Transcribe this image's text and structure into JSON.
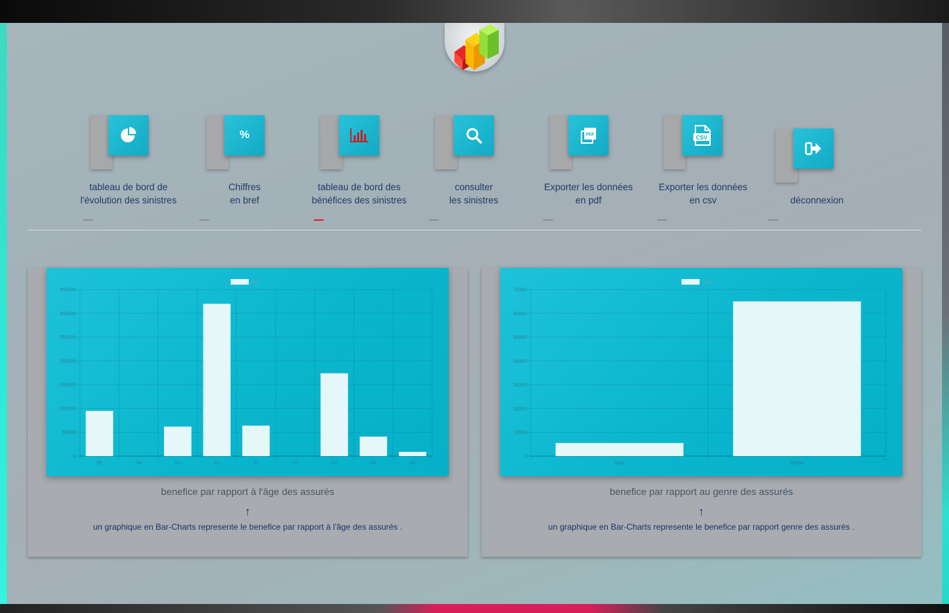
{
  "nav": {
    "items": [
      {
        "label": "tableau de bord de\nl'évolution des sinistres",
        "icon": "pie-chart-icon",
        "active": false
      },
      {
        "label": "Chiffres\nen bref",
        "icon": "percent-icon",
        "icon_text": "%",
        "active": false
      },
      {
        "label": "tableau de bord des\nbénéfices des sinistres",
        "icon": "bar-chart-icon",
        "active": true
      },
      {
        "label": "consulter\nles sinistres",
        "icon": "search-icon",
        "active": false
      },
      {
        "label": "Exporter les données\nen pdf",
        "icon": "pdf-icon",
        "icon_text": "PDF",
        "active": false
      },
      {
        "label": "Exporter les données\nen csv",
        "icon": "csv-icon",
        "icon_text": "CSV",
        "active": false
      },
      {
        "label": "déconnexion",
        "icon": "logout-icon",
        "active": false
      }
    ]
  },
  "cards": [
    {
      "title": "benefice par rapport à l'âge des assurés",
      "arrow": "↑",
      "description": "un graphique en Bar-Charts represente le benefice par rapport à l'âge des assurés ."
    },
    {
      "title": "benefice par rapport au genre des assurés",
      "arrow": "↑",
      "description": "un graphique en Bar-Charts represente le benefice par rapport genre des assurés ."
    }
  ],
  "colors": {
    "accent": "#13aac4",
    "active_underline": "#d8232a",
    "bar_fill": "#e6f7fa"
  },
  "chart_data": [
    {
      "type": "bar",
      "legend": "age",
      "categories": [
        "55",
        "54",
        "60",
        "62",
        "51",
        "10",
        "50",
        "58",
        "40"
      ],
      "values": [
        95000,
        0,
        62000,
        320000,
        64000,
        0,
        174000,
        41000,
        9000
      ],
      "ylim": [
        0,
        350000
      ],
      "yticks": [
        0,
        50000,
        100000,
        150000,
        200000,
        250000,
        300000,
        350000
      ],
      "grid": true
    },
    {
      "type": "bar",
      "legend": "genre",
      "categories": [
        "male",
        "female"
      ],
      "values": [
        5500,
        65000
      ],
      "ylim": [
        0,
        70000
      ],
      "yticks": [
        0,
        10000,
        20000,
        30000,
        40000,
        50000,
        60000,
        70000
      ],
      "grid": true
    }
  ]
}
